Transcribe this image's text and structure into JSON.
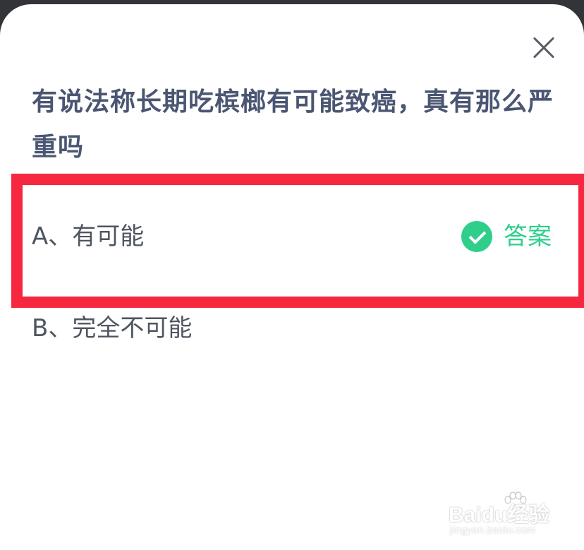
{
  "dialog": {
    "close_icon": "close-icon",
    "question": "有说法称长期吃槟榔有可能致癌，真有那么严重吗",
    "options": [
      {
        "label": "A、有可能",
        "is_answer": true
      },
      {
        "label": "B、完全不可能",
        "is_answer": false
      }
    ],
    "answer_label": "答案",
    "answer_icon": "check-circle-icon"
  },
  "watermark": {
    "brand": "Baidu经验",
    "url": "jingyan.baidu.com"
  },
  "colors": {
    "accent_green": "#2fce8b",
    "highlight_red": "#f5283f",
    "question_text": "#4a5672",
    "option_text": "#4e5560"
  }
}
